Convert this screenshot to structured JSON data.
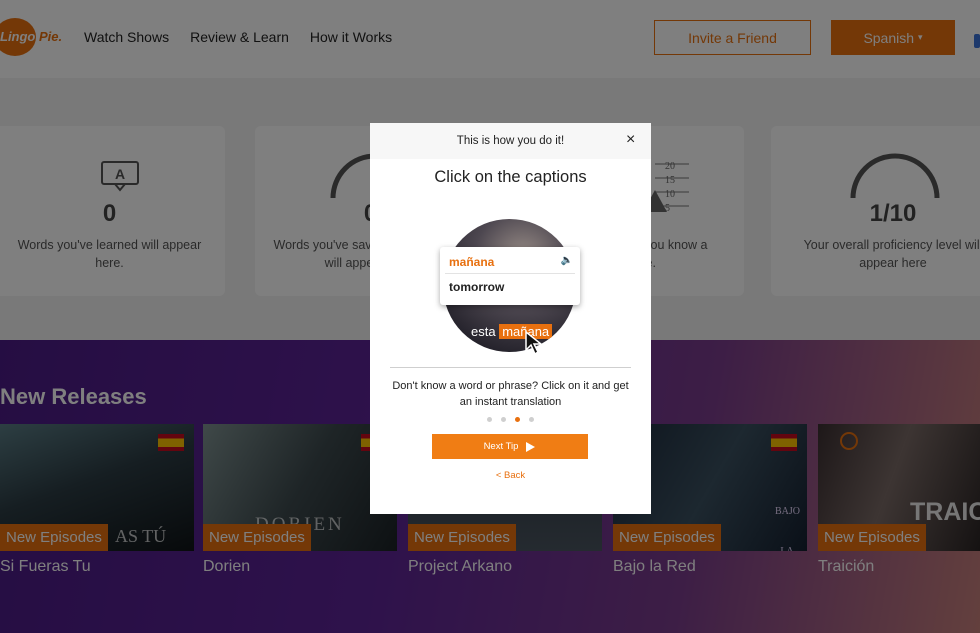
{
  "header": {
    "logo": {
      "part1": "Lingo",
      "part2": "Pie."
    },
    "nav": [
      "Watch Shows",
      "Review & Learn",
      "How it Works"
    ],
    "invite_label": "Invite a Friend",
    "language_label": "Spanish",
    "language_caret": "▾"
  },
  "stats": [
    {
      "value": "0",
      "description": "Words you've learned will appear here.",
      "icon": "caption-bubble-icon"
    },
    {
      "value": "0",
      "description": "Words you've saved to Flash cards will appear here.",
      "icon": "gauge-icon"
    },
    {
      "value": "",
      "description": "Watch the better you know a language.",
      "icon": "level-chart-icon",
      "scale": [
        "20",
        "15",
        "10",
        "5"
      ]
    },
    {
      "value": "1/10",
      "description": "Your overall proficiency level will appear here",
      "icon": "gauge-icon"
    }
  ],
  "releases": {
    "title": "New Releases",
    "badge_label": "New Episodes",
    "shows": [
      {
        "title": "Si Fueras Tu",
        "overlay_text": "AS TÚ"
      },
      {
        "title": "Dorien",
        "overlay_text": "DORIEN"
      },
      {
        "title": "Project Arkano",
        "overlay_text": ""
      },
      {
        "title": "Bajo la Red",
        "overlay_text": "BAJO LA RED"
      },
      {
        "title": "Traición",
        "overlay_text": "TRAIC"
      }
    ]
  },
  "modal": {
    "header": "This is how you do it!",
    "close": "×",
    "title": "Click on the captions",
    "popup_word": "mañana",
    "popup_translation": "tomorrow",
    "caption_prefix": "esta ",
    "caption_highlight": "mañana",
    "body": "Don't know a word or phrase? Click on it and get an instant translation",
    "dots": 4,
    "active_dot": 3,
    "next_label": "Next Tip",
    "back_label": "< Back"
  },
  "colors": {
    "accent": "#e8700f",
    "purple": "#5d2497"
  }
}
